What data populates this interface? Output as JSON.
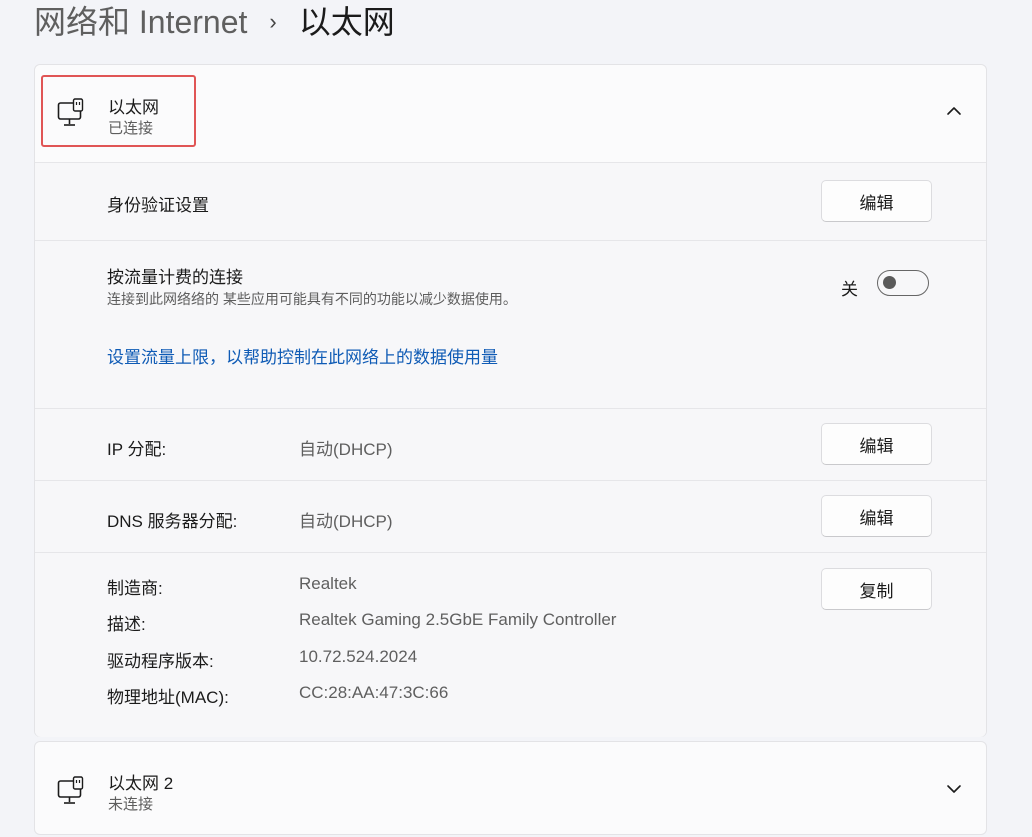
{
  "breadcrumb": {
    "parent": "网络和 Internet",
    "separator": "›",
    "current": "以太网"
  },
  "adapter1": {
    "name": "以太网",
    "status": "已连接",
    "expanded": true,
    "icon": "ethernet-icon",
    "chevron_icon": "chevron-up-icon",
    "auth": {
      "label": "身份验证设置",
      "button": "编辑"
    },
    "metered": {
      "label": "按流量计费的连接",
      "description": "连接到此网络络的 某些应用可能具有不同的功能以减少数据使用。",
      "state_label": "关",
      "on": false,
      "link": "设置流量上限，以帮助控制在此网络上的数据使用量"
    },
    "ip": {
      "label": "IP 分配:",
      "value": "自动(DHCP)",
      "button": "编辑"
    },
    "dns": {
      "label": "DNS 服务器分配:",
      "value": "自动(DHCP)",
      "button": "编辑"
    },
    "details": {
      "copy_button": "复制",
      "manufacturer_label": "制造商:",
      "manufacturer": "Realtek",
      "description_label": "描述:",
      "description": "Realtek Gaming 2.5GbE Family Controller",
      "driver_label": "驱动程序版本:",
      "driver": "10.72.524.2024",
      "mac_label": "物理地址(MAC):",
      "mac": "CC:28:AA:47:3C:66"
    }
  },
  "adapter2": {
    "name": "以太网 2",
    "status": "未连接",
    "expanded": false,
    "icon": "ethernet-icon",
    "chevron_icon": "chevron-down-icon"
  },
  "colors": {
    "link": "#0f5bb5",
    "highlight": "#e05555",
    "background": "#f3f4f8"
  }
}
